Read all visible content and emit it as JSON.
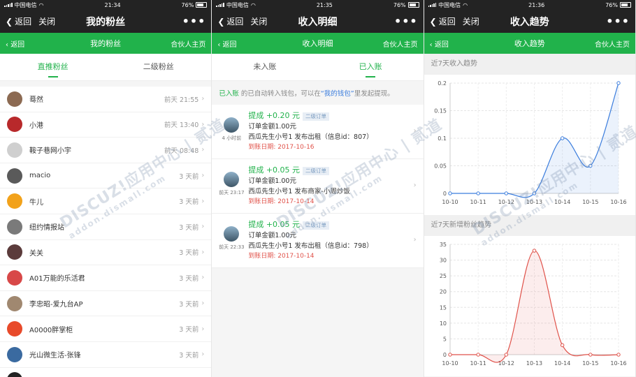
{
  "screen1": {
    "status": {
      "carrier": "中国电信",
      "time": "21:34",
      "battery": "76%"
    },
    "nav": {
      "back": "返回",
      "close": "关闭",
      "title": "我的粉丝",
      "more": "•••"
    },
    "greenbar": {
      "back": "返回",
      "title": "我的粉丝",
      "right": "合伙人主页"
    },
    "tabs": [
      "直推粉丝",
      "二级粉丝"
    ],
    "fans": [
      {
        "name": "蓦然",
        "time": "前天 21:55",
        "color": "#8c6a52"
      },
      {
        "name": "小港",
        "time": "前天 13:40",
        "color": "#b8292b"
      },
      {
        "name": "鞍子巷网小宇",
        "time": "前天 08:48",
        "color": "#cfcfcf"
      },
      {
        "name": "macio",
        "time": "3 天前",
        "color": "#5a5a5a"
      },
      {
        "name": "牛儿",
        "time": "3 天前",
        "color": "#f2a21b"
      },
      {
        "name": "纽约情报站",
        "time": "3 天前",
        "color": "#7a7a7a"
      },
      {
        "name": "关关",
        "time": "3 天前",
        "color": "#5b3b3b"
      },
      {
        "name": "A01万能的乐活君",
        "time": "3 天前",
        "color": "#d84848"
      },
      {
        "name": "李忠昭-爱九台AP",
        "time": "3 天前",
        "color": "#a08870"
      },
      {
        "name": "A0000胖掌柜",
        "time": "3 天前",
        "color": "#e84a2a"
      },
      {
        "name": "光山微生活-张锋",
        "time": "3 天前",
        "color": "#3a6aa0"
      },
      {
        "name": "",
        "time": "",
        "color": "#222"
      }
    ]
  },
  "screen2": {
    "status": {
      "carrier": "中国电信",
      "time": "21:35",
      "battery": "76%"
    },
    "nav": {
      "back": "返回",
      "close": "关闭",
      "title": "收入明细",
      "more": "•••"
    },
    "greenbar": {
      "back": "返回",
      "title": "收入明细",
      "right": "合伙人主页"
    },
    "tabs": [
      "未入账",
      "已入账"
    ],
    "notice": {
      "p1": "已入账",
      "p2": " 的已自动转入钱包，可以在",
      "p3": "“我的钱包”",
      "p4": "里发起提现。"
    },
    "items": [
      {
        "amount": "提成 +0.20 元",
        "tag": "二级订单",
        "order": "订单金额1.00元",
        "desc": "西瓜先生小号1 发布出租（信息id：807）",
        "date": "到账日期: 2017-10-16",
        "ago": "4 小时前"
      },
      {
        "amount": "提成 +0.05 元",
        "tag": "二级订单",
        "order": "订单金额1.00元",
        "desc": "西瓜先生小号1 发布商家-小周炒饭",
        "date": "到账日期: 2017-10-14",
        "ago": "前天 23:17"
      },
      {
        "amount": "提成 +0.05 元",
        "tag": "二级订单",
        "order": "订单金额1.00元",
        "desc": "西瓜先生小号1 发布出租（信息id：798）",
        "date": "到账日期: 2017-10-14",
        "ago": "前天 22:33"
      }
    ]
  },
  "screen3": {
    "status": {
      "carrier": "中国电信",
      "time": "21:36",
      "battery": "76%"
    },
    "nav": {
      "back": "返回",
      "close": "关闭",
      "title": "收入趋势",
      "more": "•••"
    },
    "greenbar": {
      "back": "返回",
      "title": "收入趋势",
      "right": "合伙人主页"
    },
    "section1": "近7天收入趋势",
    "section2": "近7天新增粉丝趋势"
  },
  "watermark": {
    "main": "DISCUZ!应用中心 | 贰道",
    "sub": "addon.dismall.com"
  },
  "colors": {
    "accent": "#21b24b",
    "line1": "#3b7ddd",
    "line2": "#e0524a"
  },
  "chart_data": [
    {
      "type": "area",
      "title": "近7天收入趋势",
      "categories": [
        "10-10",
        "10-11",
        "10-12",
        "10-13",
        "10-14",
        "10-15",
        "10-16"
      ],
      "values": [
        0,
        0,
        0,
        0,
        0.1,
        0.05,
        0.2
      ],
      "yticks": [
        0,
        0.05,
        0.1,
        0.15,
        0.2
      ],
      "ylim": [
        0,
        0.2
      ],
      "grid": true
    },
    {
      "type": "area",
      "title": "近7天新增粉丝趋势",
      "categories": [
        "10-10",
        "10-11",
        "10-12",
        "10-13",
        "10-14",
        "10-15",
        "10-16"
      ],
      "values": [
        0,
        0,
        0,
        33,
        3,
        0,
        0
      ],
      "yticks": [
        0,
        5,
        10,
        15,
        20,
        25,
        30,
        35
      ],
      "ylim": [
        0,
        35
      ],
      "grid": true
    }
  ]
}
